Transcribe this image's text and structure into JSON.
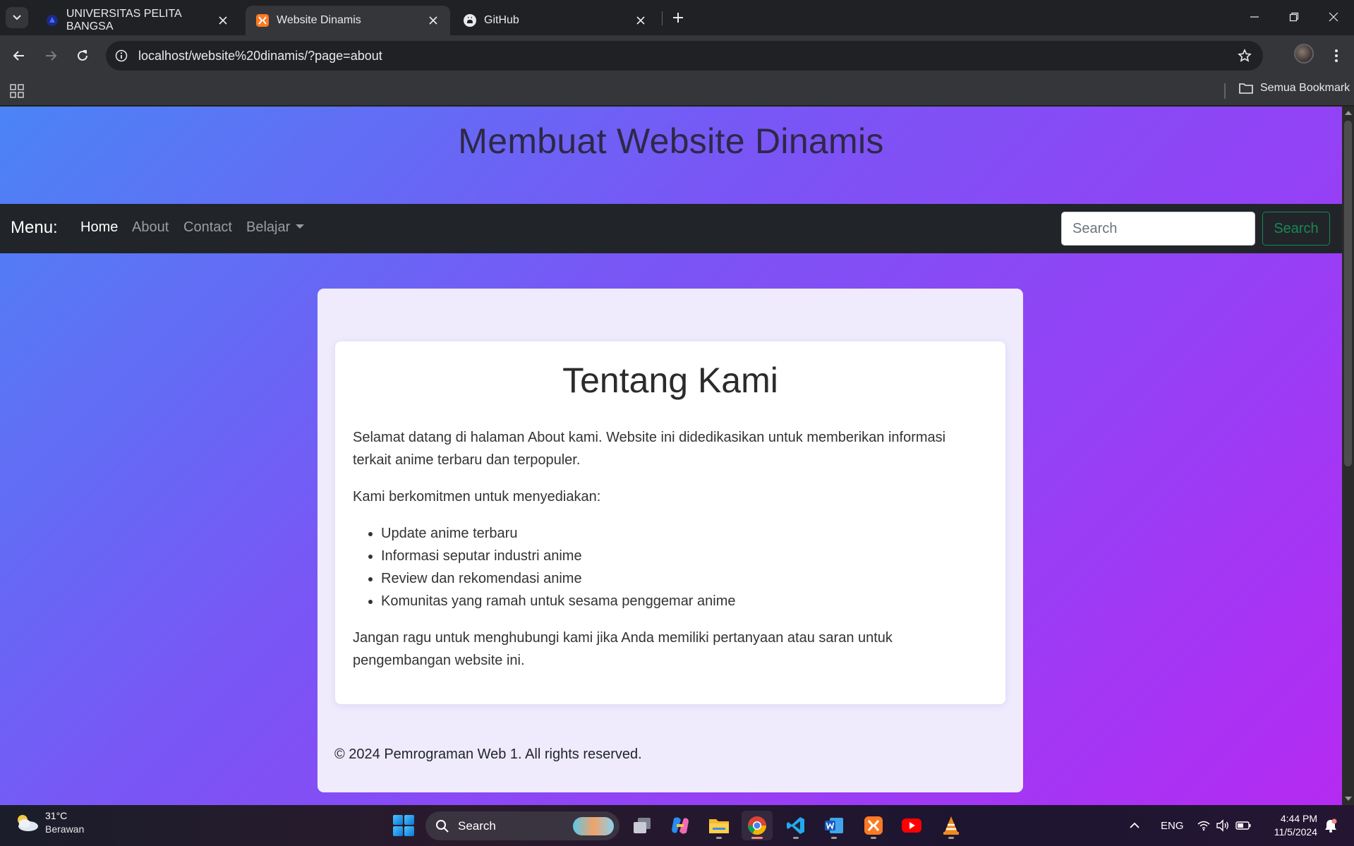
{
  "browser": {
    "tabs": [
      {
        "title": "UNIVERSITAS PELITA BANGSA",
        "active": false,
        "icon": "university-logo-icon"
      },
      {
        "title": "Website Dinamis",
        "active": true,
        "icon": "xampp-icon"
      },
      {
        "title": "GitHub",
        "active": false,
        "icon": "github-icon"
      }
    ],
    "url": "localhost/website%20dinamis/?page=about",
    "bookmarks_all_label": "Semua Bookmark"
  },
  "page": {
    "hero_title": "Membuat Website Dinamis",
    "nav": {
      "brand": "Menu:",
      "links": [
        "Home",
        "About",
        "Contact",
        "Belajar"
      ],
      "search_placeholder": "Search",
      "search_button": "Search"
    },
    "about": {
      "heading": "Tentang Kami",
      "intro": "Selamat datang di halaman About kami. Website ini didedikasikan untuk memberikan informasi terkait anime terbaru dan terpopuler.",
      "commitment": "Kami berkomitmen untuk menyediakan:",
      "items": [
        "Update anime terbaru",
        "Informasi seputar industri anime",
        "Review dan rekomendasi anime",
        "Komunitas yang ramah untuk sesama penggemar anime"
      ],
      "closing": "Jangan ragu untuk menghubungi kami jika Anda memiliki pertanyaan atau saran untuk pengembangan website ini."
    },
    "footer": "© 2024 Pemrograman Web 1. All rights reserved."
  },
  "taskbar": {
    "weather_temp": "31°C",
    "weather_condition": "Berawan",
    "search_label": "Search",
    "language": "ENG",
    "time": "4:44 PM",
    "date": "11/5/2024"
  },
  "colors": {
    "gradient_start": "#4b84f5",
    "gradient_end": "#b52af2",
    "navbar_bg": "#212529",
    "search_button": "#198754"
  }
}
